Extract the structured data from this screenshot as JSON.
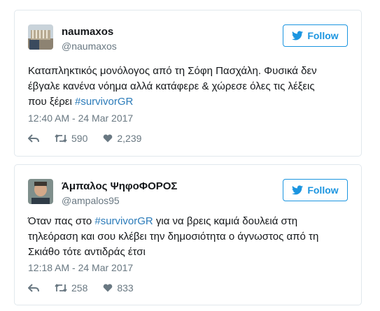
{
  "tweets": [
    {
      "display_name": "naumaxos",
      "handle": "@naumaxos",
      "follow_label": "Follow",
      "text_lines": [
        "Καταπληκτικός μονόλογος από τη Σόφη Πασχάλη. Φυσικά δεν",
        "έβγαλε κανένα νόημα αλλά κατάφερε & χώρεσε όλες τις λέξεις",
        "που ξέρει "
      ],
      "hashtag": "#survivorGR",
      "timestamp": "12:40 AM - 24 Mar 2017",
      "retweets": "590",
      "likes": "2,239"
    },
    {
      "display_name": "Άμπαλος ΨηφοΦΟΡΟΣ",
      "handle": "@ampalos95",
      "follow_label": "Follow",
      "text_before": "Όταν πας στο ",
      "hashtag": "#survivorGR",
      "text_after": " για να βρεις καμιά δουλειά στη",
      "text_lines": [
        "τηλεόραση και σου κλέβει την δημοσιότητα ο άγνωστος από τη",
        "Σκιάθο τότε αντιδράς έτσι"
      ],
      "timestamp": "12:18 AM - 24 Mar 2017",
      "retweets": "258",
      "likes": "833"
    }
  ],
  "colors": {
    "accent": "#1b95e0",
    "hashtag": "#2b7bb9",
    "muted": "#697882",
    "border": "#e1e8ed"
  },
  "icons": [
    "bird-icon",
    "reply-icon",
    "retweet-icon",
    "heart-icon"
  ]
}
